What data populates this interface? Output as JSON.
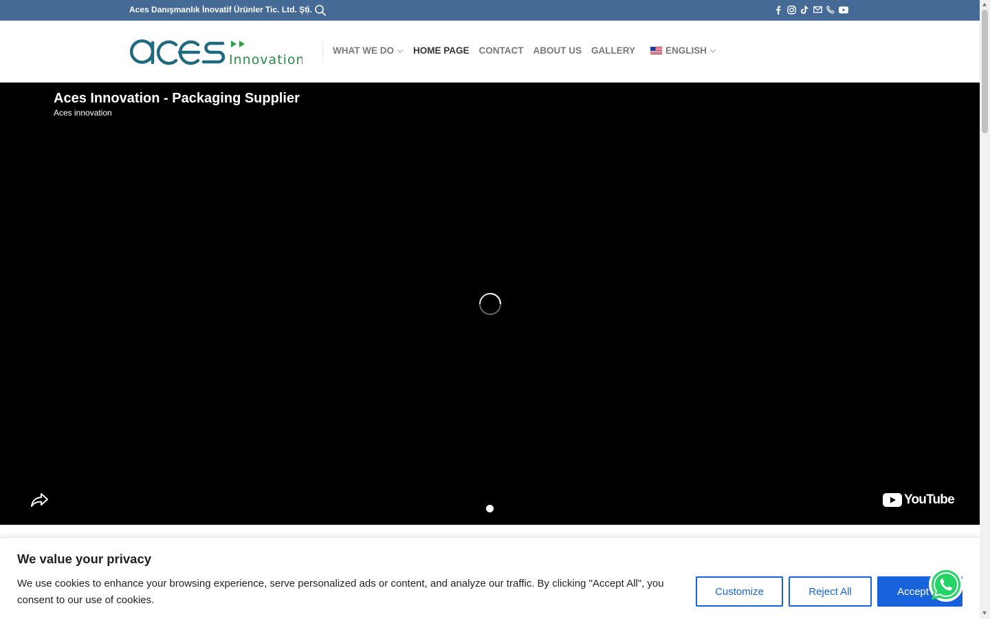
{
  "topbar": {
    "company": "Aces Danışmanlık İnovatif Ürünler Tic. Ltd. Şti.",
    "search_icon": "search-icon",
    "social": [
      "facebook-icon",
      "instagram-icon",
      "tiktok-icon",
      "email-icon",
      "phone-icon",
      "youtube-icon"
    ]
  },
  "logo": {
    "main": "aces",
    "sub": "Innovation",
    "arrow_color": "#2aa04a",
    "text_color": "#1f6a7e",
    "sub_color": "#2a8d47"
  },
  "nav": {
    "items": [
      "WHAT WE DO",
      "HOME PAGE",
      "CONTACT",
      "ABOUT US",
      "GALLERY"
    ],
    "active": "HOME PAGE",
    "language": "ENGLISH"
  },
  "video": {
    "title": "Aces Innovation - Packaging Supplier",
    "channel": "Aces innovation",
    "brand": "YouTube",
    "state": "loading"
  },
  "cookie": {
    "title": "We value your privacy",
    "text": "We use cookies to enhance your browsing experience, serve personalized ads or content, and analyze our traffic. By clicking \"Accept All\", you consent to our use of cookies.",
    "buttons": {
      "customize": "Customize",
      "reject": "Reject All",
      "accept": "Accept All"
    },
    "accent": "#1863dc"
  },
  "colors": {
    "topbar": "#456a96",
    "nav_text": "#787878",
    "nav_active": "#333333"
  }
}
